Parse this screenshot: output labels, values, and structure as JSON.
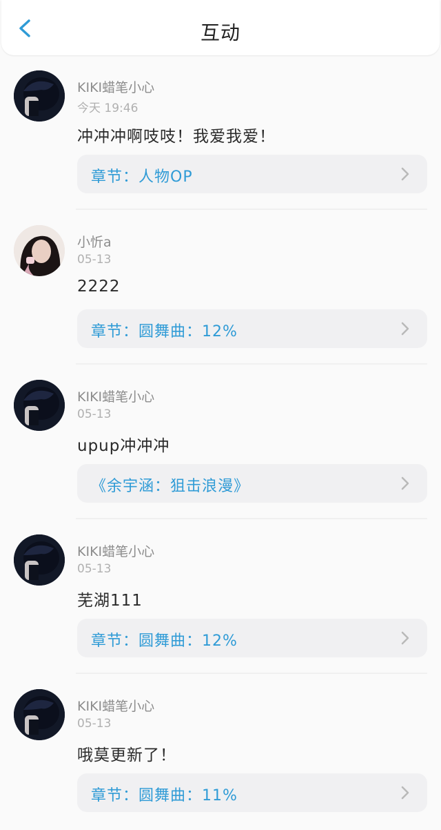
{
  "header": {
    "title": "互动",
    "back_icon": "chevron-left-icon"
  },
  "colors": {
    "accent": "#2f9bd6",
    "card_bg": "#f0f0f2"
  },
  "items": [
    {
      "username": "KIKI蜡笔小心",
      "time": "今天 19:46",
      "comment": "冲冲冲啊吱吱！我爱我爱！",
      "chapter": "章节：人物OP",
      "avatar": "dark-hair-avatar"
    },
    {
      "username": "小忻a",
      "time": "05-13",
      "comment": "2222",
      "chapter": "章节：圆舞曲：12%",
      "avatar": "girl-photo-avatar"
    },
    {
      "username": "KIKI蜡笔小心",
      "time": "05-13",
      "comment": "upup冲冲冲",
      "chapter": "《余宇涵：狙击浪漫》",
      "avatar": "dark-hair-avatar"
    },
    {
      "username": "KIKI蜡笔小心",
      "time": "05-13",
      "comment": "芜湖111",
      "chapter": "章节：圆舞曲：12%",
      "avatar": "dark-hair-avatar"
    },
    {
      "username": "KIKI蜡笔小心",
      "time": "05-13",
      "comment": "哦莫更新了！",
      "chapter": "章节：圆舞曲：11%",
      "avatar": "dark-hair-avatar"
    }
  ]
}
